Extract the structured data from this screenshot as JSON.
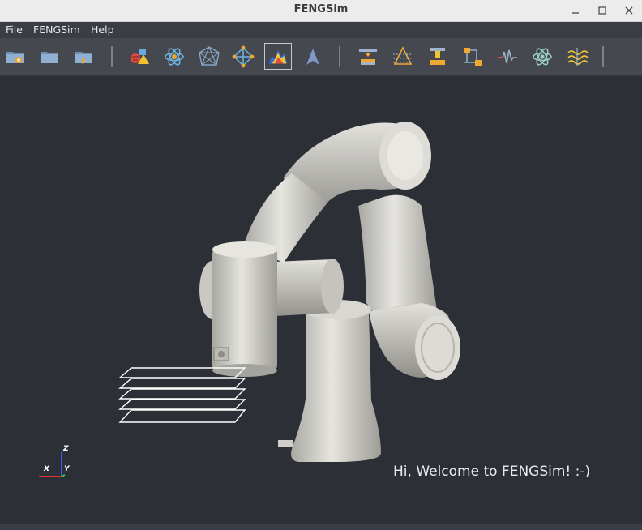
{
  "window": {
    "title": "FENGSim"
  },
  "menu": {
    "items": [
      "File",
      "FENGSim",
      "Help"
    ]
  },
  "toolbar": {
    "buttons": [
      {
        "icon": "new-file-icon"
      },
      {
        "icon": "open-folder-icon"
      },
      {
        "icon": "import-folder-icon"
      },
      {
        "icon": "cad-primitives-icon"
      },
      {
        "icon": "physics-atom-icon"
      },
      {
        "icon": "mesh-icon"
      },
      {
        "icon": "solver-icon"
      },
      {
        "icon": "visualization-icon",
        "active": true
      },
      {
        "icon": "arrow-cursor-icon"
      },
      {
        "icon": "additive-manufacturing-icon"
      },
      {
        "icon": "slicing-icon"
      },
      {
        "icon": "machining-icon"
      },
      {
        "icon": "process-flow-icon"
      },
      {
        "icon": "signal-icon"
      },
      {
        "icon": "atom-icon"
      },
      {
        "icon": "waves-icon"
      }
    ]
  },
  "viewport": {
    "welcome_text": "Hi, Welcome to FENGSim! :-)",
    "axes": {
      "z": "Z",
      "x": "X",
      "y": "Y"
    }
  },
  "colors": {
    "background": "#2c2f36",
    "toolbar": "#45484f",
    "model": "#d9d7d2"
  }
}
